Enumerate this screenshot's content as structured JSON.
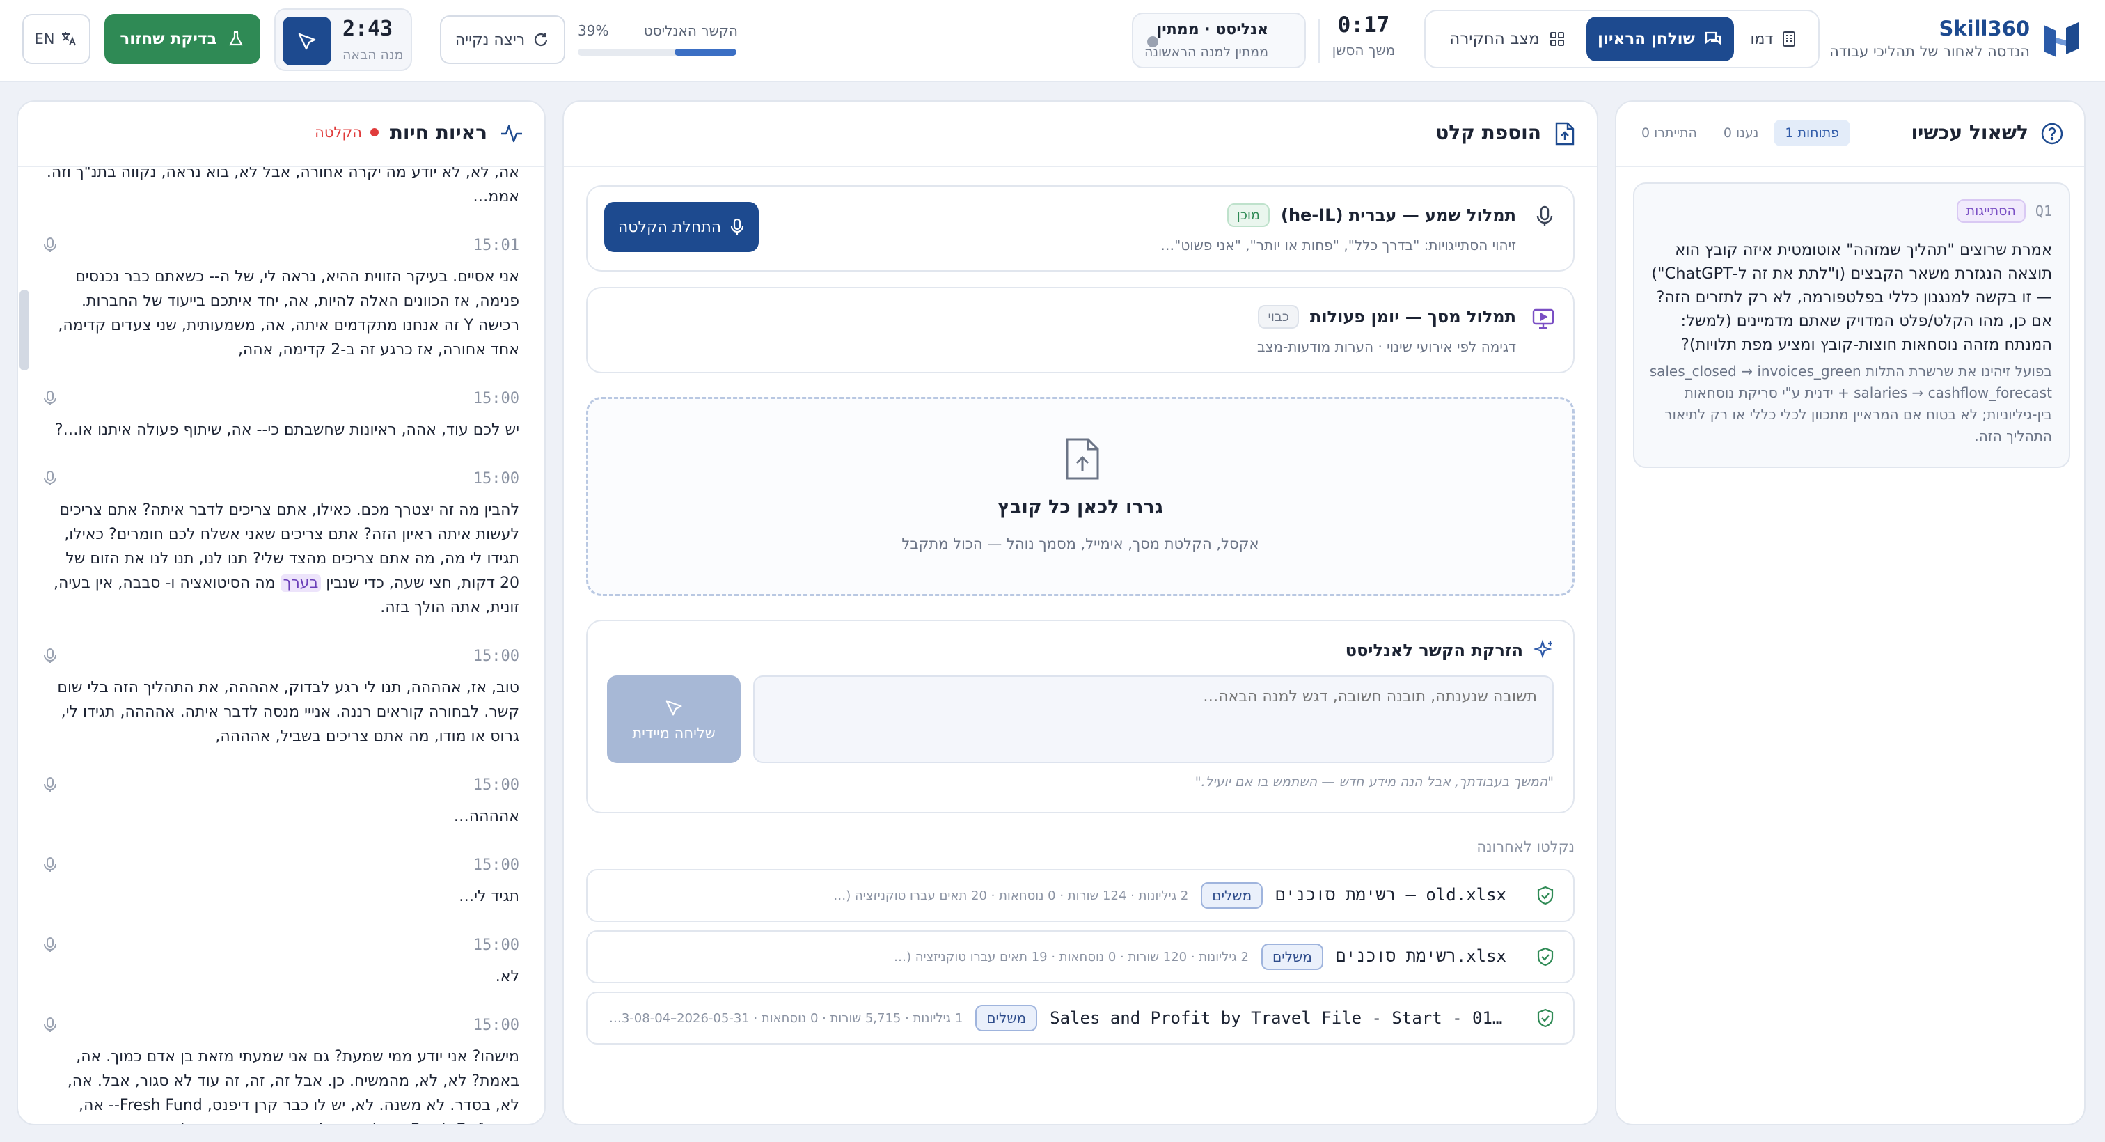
{
  "brand": {
    "name": "Skill360",
    "tagline": "הנדסה לאחור של תהליכי עבודה"
  },
  "modes": {
    "demo": "דמו",
    "analyst_table": "שולחן הראיון",
    "research_state": "מצב החקירה"
  },
  "session": {
    "timer": "0:17",
    "timer_label": "משך הסשן",
    "analyst_state": "אנליסט · ממתין",
    "analyst_sub": "ממתין למנה הראשונה"
  },
  "context_meter": {
    "label": "הקשר האנליסט",
    "percent": "39%",
    "value": 0.39
  },
  "clean_run": "ריצה נקייה",
  "next_batch": {
    "time": "2:43",
    "label": "מנה הבאה"
  },
  "test_button": "בדיקת שחזור",
  "lang_button": "EN",
  "colors": {
    "primary": "#1d4a8f",
    "green": "#2f8a55",
    "purple": "#7a4fc4",
    "red": "#e03b3b"
  },
  "questions": {
    "title": "לשאול עכשיו",
    "tabs": [
      "פתוחות 1",
      "נענו 0",
      "התייתרו 0"
    ],
    "items": [
      {
        "id": "Q1",
        "tag": "הסתייגות",
        "text": "אמרת שרוצים \"תהליך שמזהה\" אוטומטית איזה קובץ הוא תוצאה הנגזרת משאר הקבצים (ו\"לתת את זה ל-ChatGPT\") — זו בקשה למנגנון כללי בפלטפורמה, לא רק לתזרים הזה? אם כן, מהו הקלט/פלט המדויק שאתם מדמיינים (למשל: המנתח מזהה נוסחאות חוצות-קובץ ומציע מפת תלויות)?",
        "note": "בפועל זיהינו את שרשרת התלות sales_closed → invoices_green + salaries → cashflow_forecast ידנית ע\"י סריקת נוסחאות בין-גיליוניות; לא בטוח אם המראיין מתכוון לכלי כללי או רק לתיאור התהליך הזה."
      }
    ]
  },
  "input": {
    "title": "הוספת קלט",
    "audio": {
      "title": "תמלול שמע — עברית (he-IL)",
      "status": "מוכן",
      "subtitle": "זיהוי הסתייגויות: \"בדרך כלל\", \"פחות או יותר\", \"אני פשוט\"…",
      "button": "התחלת הקלטה"
    },
    "screen": {
      "title": "תמלול מסך — יומן פעולות",
      "status": "כבוי",
      "subtitle": "דגימה לפי אירועי שינוי · הערות מודעות-מצב"
    },
    "dropzone": {
      "title": "גררו לכאן כל קובץ",
      "subtitle": "אקסל, הקלטת מסך, אימייל, מסמך נוהל — הכול מתקבל"
    },
    "inject": {
      "title": "הזרקת הקשר לאנליסט",
      "placeholder": "תשובה שנענתה, תובנה חשובה, דגש למנה הבאה…",
      "send": "שליחה מיידית",
      "hint": "\"המשך בעבודתך, אבל הנה מידע חדש — השתמש בו אם יועיל.\""
    },
    "recent_title": "נקלטו לאחרונה",
    "files": [
      {
        "name": "רשימת סוכנים – old.xlsx",
        "badge": "משלים",
        "meta": "2 גיליונות · 124 שורות · 0 נוסחאות · 20 תאים עברו טוקניזציה (2…"
      },
      {
        "name": "רשימת סוכנים.xlsx",
        "badge": "משלים",
        "meta": "2 גיליונות · 120 שורות · 0 נוסחאות · 19 תאים עברו טוקניזציה (2…"
      },
      {
        "name": "Sales and Profit by Travel File - Start - 01.01…",
        "badge": "משלים",
        "meta": "1 גיליונות · 5,715 שורות · 0 נוסחאות · 2026-05-31–2023-08-04…"
      }
    ]
  },
  "live": {
    "title": "ראיות חיות",
    "recording": "הקלטה",
    "top_text": "אה, לא, לא יודע מה יקרה אחורה, אבל לא, בוא נראה, נקווה בתנ\"ך וזה. אממ…",
    "messages": [
      {
        "time": "15:01",
        "pre": "אני אסיים. בעיקר הזווית ההיא, נראה לי, של ה-- כשאתם כבר נכנסים פנימה, אז הכוונים האלה להיות, אה, יחד איתכם בייעוד של החברות. רכישה Y זה אנחנו מתקדמים איתה, אה, משמעותית, שני צעדים קדימה, אחד אחורה, אז כרגע זה ב-2 קדימה, אהה,",
        "hl": "",
        "post": ""
      },
      {
        "time": "15:00",
        "pre": "יש לכם עוד, אהה, ראיונות שחשבתם כי-- אה, שיתוף פעולה איתנו או…?",
        "hl": "",
        "post": ""
      },
      {
        "time": "15:00",
        "pre": "להבין מה זה יצטרך מכם. כאילו, אתם צריכים לדבר איתה? אתם צריכים לעשות איתה ראיון הזה? אתם צריכים שאני אשלח לכם חומרים? כאילו, תגידו לי מה, מה אתם צריכים מהצד שלי? תנו לנו, תנו לנו את הזום של 20 דקות, חצי שעה, כדי שנבין",
        "hl": "בערך",
        "post": "מה הסיטואציה ו- סבבה, אין בעיה, זונית, אתה הולך בזה."
      },
      {
        "time": "15:00",
        "pre": "טוב, אז, אהההה, תנו לי רגע לבדוק, אהההה, את התהליך הזה בלי שום קשר. לבחורה קוראים רננה. אנייי מנסה לדבר איתה. אהההה, תגידו לי, גרוס או מודו, מה אתם צריכים בשביל, אהההה,",
        "hl": "",
        "post": ""
      },
      {
        "time": "15:00",
        "pre": "אהההה…",
        "hl": "",
        "post": ""
      },
      {
        "time": "15:00",
        "pre": "תגיד לי…",
        "hl": "",
        "post": ""
      },
      {
        "time": "15:00",
        "pre": "לא.",
        "hl": "",
        "post": ""
      },
      {
        "time": "15:00",
        "pre": "מישהו? אני יודע ממי שמעת? גם אני שמעתי מזאת בן אדם כמוך. אה, באמת? לא, לא, מהמשיח. כן. אבל זה, זה, זה עוד לא סגור, אבל. אה, לא, בסדר. לא משנה. לא, יש לו כבר קרן דיפנס, Fresh Fund-- אה, Fresh Defense, אבל נראה לי הם, אהה, מכוונים למשהו מעניין יותר.",
        "hl": "",
        "post": ""
      }
    ]
  }
}
